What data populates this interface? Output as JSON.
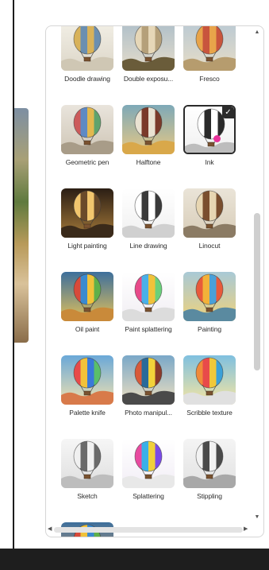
{
  "styles": [
    {
      "label": "Doodle drawing",
      "thumb": "doodle",
      "icon": "hot-air-balloon-icon"
    },
    {
      "label": "Double exposu...",
      "thumb": "double",
      "icon": "hot-air-balloon-icon"
    },
    {
      "label": "Fresco",
      "thumb": "fresco",
      "icon": "hot-air-balloon-icon"
    },
    {
      "label": "Geometric pen",
      "thumb": "geometric",
      "icon": "hot-air-balloon-icon"
    },
    {
      "label": "Halftone",
      "thumb": "halftone",
      "icon": "hot-air-balloon-icon"
    },
    {
      "label": "Ink",
      "thumb": "ink",
      "icon": "hot-air-balloon-icon",
      "selected": true
    },
    {
      "label": "Light painting",
      "thumb": "light",
      "icon": "hot-air-balloon-icon"
    },
    {
      "label": "Line drawing",
      "thumb": "line",
      "icon": "hot-air-balloon-icon"
    },
    {
      "label": "Linocut",
      "thumb": "linocut",
      "icon": "hot-air-balloon-icon"
    },
    {
      "label": "Oil paint",
      "thumb": "oil",
      "icon": "hot-air-balloon-icon"
    },
    {
      "label": "Paint splattering",
      "thumb": "splatter",
      "icon": "hot-air-balloon-icon"
    },
    {
      "label": "Painting",
      "thumb": "painting",
      "icon": "hot-air-balloon-icon"
    },
    {
      "label": "Palette knife",
      "thumb": "palette",
      "icon": "hot-air-balloon-icon"
    },
    {
      "label": "Photo manipul...",
      "thumb": "photo",
      "icon": "hot-air-balloon-icon"
    },
    {
      "label": "Scribble texture",
      "thumb": "scribble",
      "icon": "hot-air-balloon-icon"
    },
    {
      "label": "Sketch",
      "thumb": "sketch",
      "icon": "hot-air-balloon-icon"
    },
    {
      "label": "Splattering",
      "thumb": "splattering",
      "icon": "hot-air-balloon-icon"
    },
    {
      "label": "Stippling",
      "thumb": "stippling",
      "icon": "hot-air-balloon-icon"
    },
    {
      "label": "",
      "thumb": "partial",
      "icon": "hot-air-balloon-icon"
    }
  ],
  "selected_style": "Ink",
  "selected_icons": {
    "check": "checkmark-icon"
  },
  "scrollbar": {
    "vertical_position": 0.55
  },
  "colors": {
    "selection_border": "#2b2b2b",
    "selection_marker": "#e8319a",
    "panel_border": "#d6d6d6",
    "bottom_bar": "#1e1e1e"
  }
}
